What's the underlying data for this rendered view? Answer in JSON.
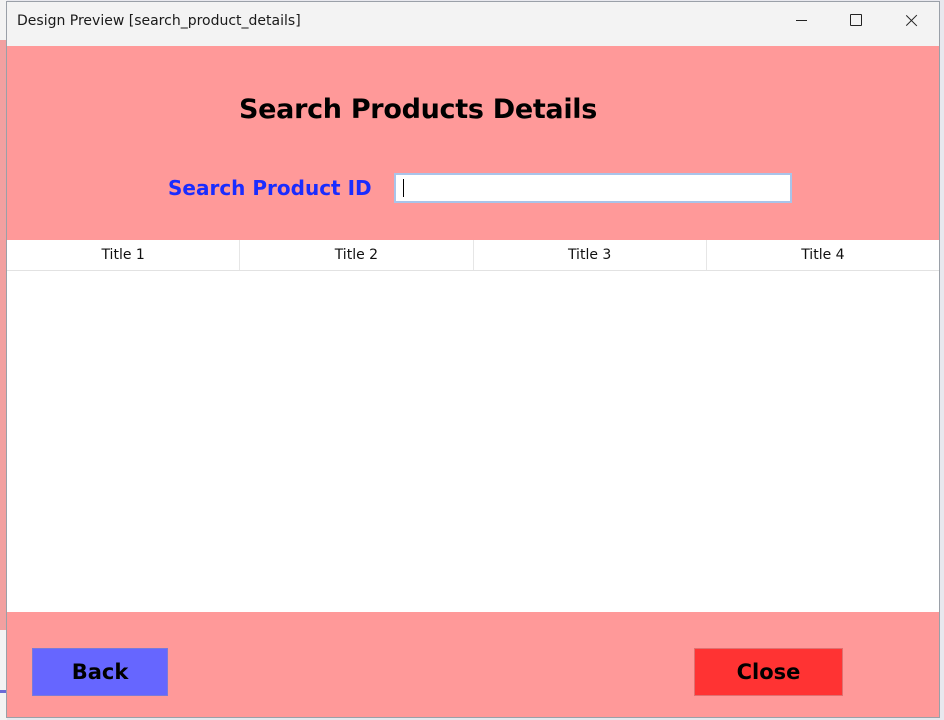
{
  "window": {
    "title": "Design Preview [search_product_details]"
  },
  "header": {
    "title": "Search Products Details",
    "search_label": "Search Product ID",
    "search_value": ""
  },
  "table": {
    "columns": [
      "Title 1",
      "Title 2",
      "Title 3",
      "Title 4"
    ],
    "rows": []
  },
  "footer": {
    "back_label": "Back",
    "close_label": "Close"
  },
  "colors": {
    "panel": "#ff9999",
    "label_blue": "#1a2cff",
    "back_button": "#6666ff",
    "close_button": "#ff3333"
  },
  "icons": {
    "minimize": "minimize-icon",
    "maximize": "maximize-icon",
    "close": "close-icon"
  }
}
